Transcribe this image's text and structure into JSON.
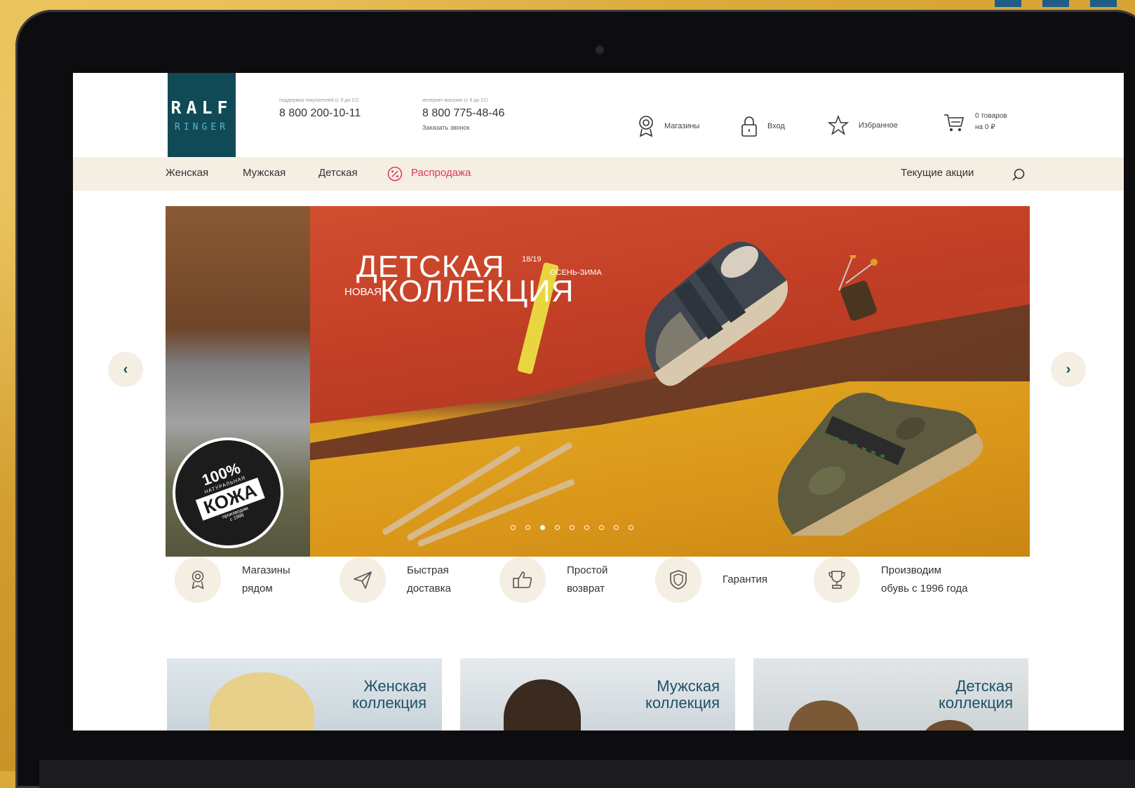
{
  "header": {
    "logo": {
      "top": "RALF",
      "bottom": "RINGER"
    },
    "phone_1": {
      "caption": "поддержка покупателей (с 8 до 21)",
      "number": "8 800 200-10-11"
    },
    "phone_2": {
      "caption": "интернет-магазин (с 8 до 21)",
      "number": "8 800 775-48-46",
      "callback": "Заказать звонок"
    },
    "stores_label": "Магазины",
    "login_label": "Вход",
    "favorites_label": "Избранное",
    "cart": {
      "count_label": "0 товаров",
      "sum_label": "на 0 ₽"
    }
  },
  "nav": {
    "items": [
      "Женская",
      "Мужская",
      "Детская"
    ],
    "sale_label": "Распродажа",
    "promo_label": "Текущие акции"
  },
  "hero": {
    "title_line_1": "ДЕТСКАЯ",
    "title_prefix": "НОВАЯ",
    "title_line_2": "КОЛЛЕКЦИЯ",
    "season_year": "18/19",
    "season_name": "ОСЕНЬ-ЗИМА",
    "badge": {
      "percent": "100%",
      "natural": "НАТУРАЛЬНАЯ",
      "leather": "КОЖА",
      "since_1": "производим",
      "since_2": "с 1996"
    },
    "slides_total": 9,
    "active_slide": 3
  },
  "features": [
    {
      "line1": "Магазины",
      "line2": "рядом",
      "icon": "map-pin-icon"
    },
    {
      "line1": "Быстрая",
      "line2": "доставка",
      "icon": "paper-plane-icon"
    },
    {
      "line1": "Простой",
      "line2": "возврат",
      "icon": "thumbs-up-icon"
    },
    {
      "line1": "Гарантия",
      "line2": "",
      "icon": "shield-icon"
    },
    {
      "line1": "Производим",
      "line2": "обувь с 1996 года",
      "icon": "trophy-icon"
    }
  ],
  "collections": [
    {
      "line1": "Женская",
      "line2": "коллекция"
    },
    {
      "line1": "Мужская",
      "line2": "коллекция"
    },
    {
      "line1": "Детская",
      "line2": "коллекция"
    }
  ],
  "colors": {
    "brand": "#0f4a56",
    "accent_sale": "#e0365a",
    "nav_bg": "#f5eee3",
    "title_blue": "#1f5066"
  }
}
